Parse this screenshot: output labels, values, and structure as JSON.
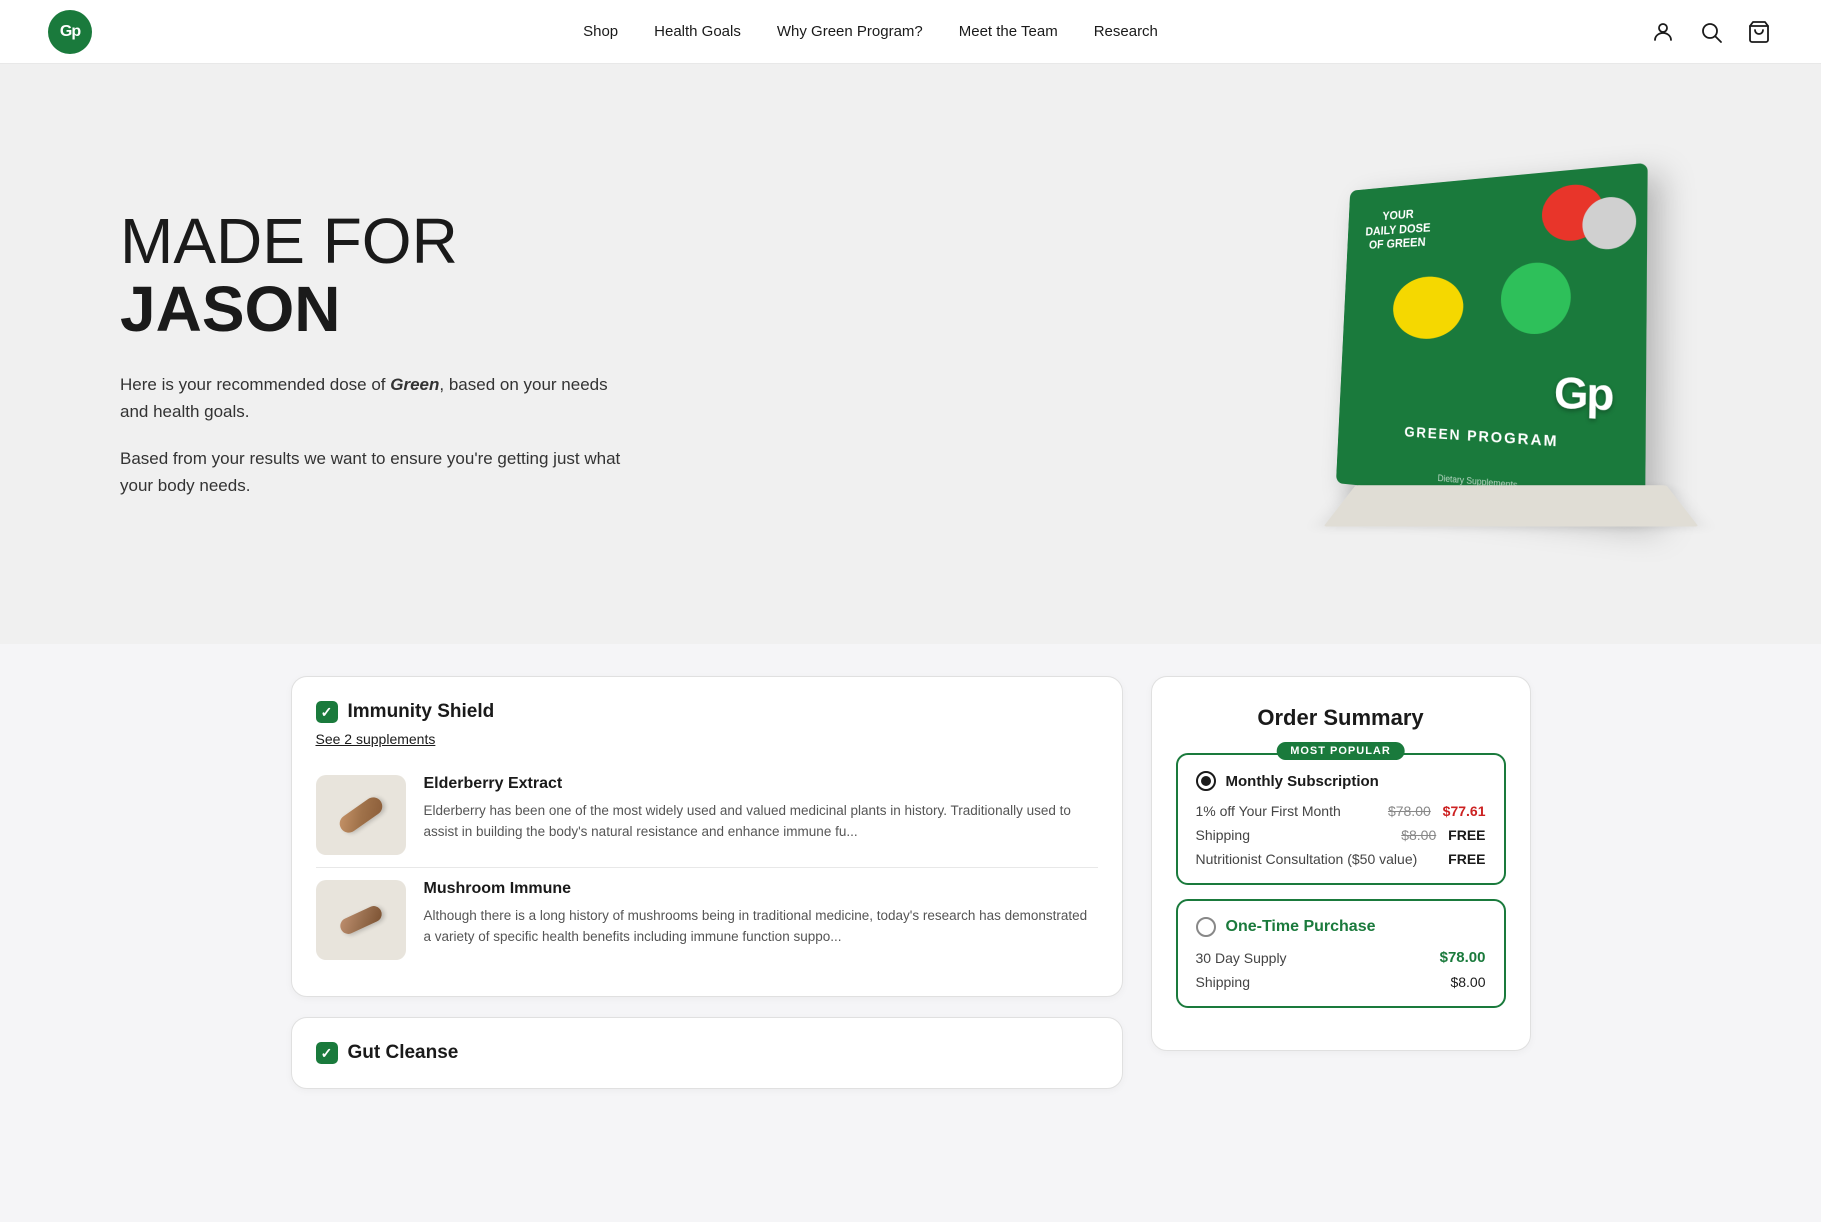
{
  "header": {
    "logo_text": "Gp",
    "nav_items": [
      {
        "label": "Shop",
        "href": "#"
      },
      {
        "label": "Health Goals",
        "href": "#"
      },
      {
        "label": "Why Green Program?",
        "href": "#"
      },
      {
        "label": "Meet the Team",
        "href": "#"
      },
      {
        "label": "Research",
        "href": "#"
      }
    ]
  },
  "hero": {
    "title_light": "MADE FOR",
    "title_bold": "JASON",
    "description_part1": "Here is your recommended dose of ",
    "description_brand": "Green",
    "description_part2": ",",
    "description_rest": " based on your needs and health goals.",
    "description2": "Based from your results we want to ensure you're getting just what your body needs.",
    "box_top_text": "YOUR\nDAILY DOSE\nOF GREEN",
    "box_brand": "GREEN PROGRAM",
    "box_sub": "Dietary Supplements"
  },
  "supplements": {
    "immunity_shield": {
      "title": "Immunity Shield",
      "see_supplements": "See 2 supplements",
      "items": [
        {
          "name": "Elderberry Extract",
          "description": "Elderberry has been one of the most widely used and valued medicinal plants in history. Traditionally used to assist in building the body's natural resistance and enhance immune fu..."
        },
        {
          "name": "Mushroom Immune",
          "description": "Although there is a long history of mushrooms being in traditional medicine, today's research has demonstrated a variety of specific health benefits including immune function suppo..."
        }
      ]
    },
    "gut_cleanse": {
      "title": "Gut Cleanse"
    }
  },
  "order_summary": {
    "title": "Order Summary",
    "plans": [
      {
        "id": "monthly",
        "badge": "MOST POPULAR",
        "name": "Monthly Subscription",
        "selected": true,
        "rows": [
          {
            "label": "1% off Your First Month",
            "original_price": "$78.00",
            "discounted_price": "$77.61"
          },
          {
            "label": "Shipping",
            "original_price": "$8.00",
            "discounted_price": "FREE"
          },
          {
            "label": "Nutritionist Consultation ($50 value)",
            "discounted_price": "FREE"
          }
        ]
      },
      {
        "id": "onetime",
        "name": "One-Time Purchase",
        "selected": false,
        "rows": [
          {
            "label": "30 Day Supply",
            "price": "$78.00"
          },
          {
            "label": "Shipping",
            "price": "$8.00"
          }
        ]
      }
    ]
  }
}
